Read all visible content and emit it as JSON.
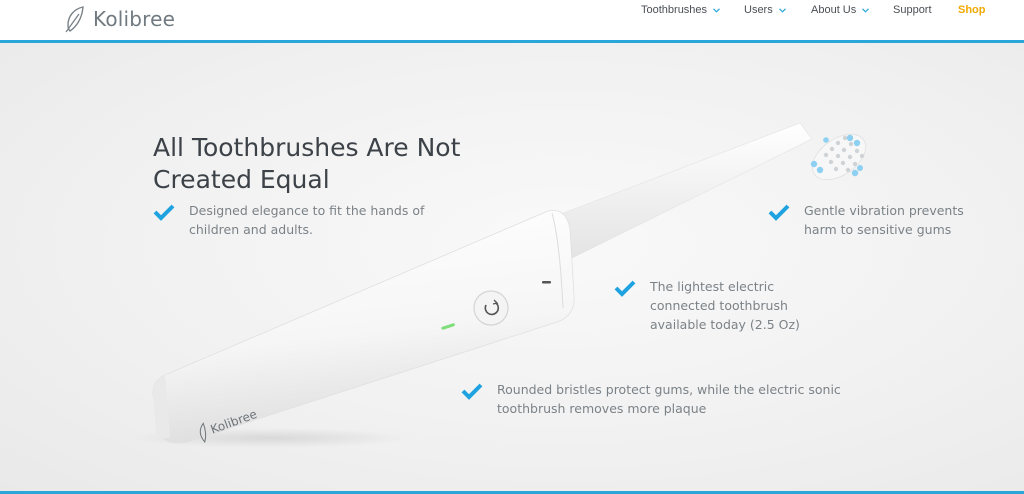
{
  "brand": {
    "name": "Kolibree"
  },
  "nav": {
    "items": [
      {
        "label": "Toothbrushes",
        "dropdown": true
      },
      {
        "label": "Users",
        "dropdown": true
      },
      {
        "label": "About Us",
        "dropdown": true
      },
      {
        "label": "Support",
        "dropdown": false
      },
      {
        "label": "Shop",
        "dropdown": false
      }
    ]
  },
  "hero": {
    "headline": "All Toothbrushes Are Not Created Equal",
    "features": [
      {
        "text": "Designed elegance to fit the hands of children and adults."
      },
      {
        "text": "Gentle vibration prevents harm to sensitive gums"
      },
      {
        "text": "The lightest electric connected toothbrush available today (2.5 Oz)"
      },
      {
        "text": "Rounded bristles protect gums, while the electric sonic toothbrush removes more plaque"
      }
    ],
    "product_label": "Kolibree"
  },
  "colors": {
    "accent": "#2aa7d8",
    "check": "#1fa3e0",
    "shop": "#f2a900",
    "headline": "#3c4248",
    "body_text": "#7b8287"
  }
}
